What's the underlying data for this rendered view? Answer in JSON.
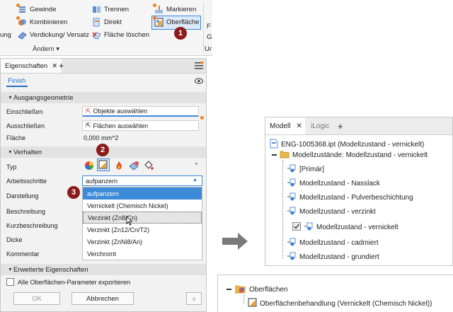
{
  "ribbon": {
    "col1": [
      "Gewinde",
      "Kombinieren",
      "Verdickung/ Versatz"
    ],
    "col1_partial": "ung",
    "col2": [
      "Trennen",
      "Direkt",
      "Fläche löschen"
    ],
    "col3": [
      "Markieren",
      "Oberfläche"
    ],
    "col4_partial": [
      "F",
      "G",
      "Ur"
    ],
    "group_label": "Ändern ▾"
  },
  "badges": {
    "one": "1",
    "two": "2",
    "three": "3"
  },
  "properties": {
    "tab_title": "Eigenschaften",
    "tab_close": "✕",
    "tab_add": "+",
    "finish": "Finish",
    "section_input": "Ausgangsgeometrie",
    "einschliessen_label": "Einschließen",
    "einschliessen_value": "Objekte auswählen",
    "ausschliessen_label": "Ausschließen",
    "ausschliessen_value": "Flächen auswählen",
    "flaeche_label": "Fläche",
    "flaeche_value": "0,000 mm^2",
    "section_behavior": "Verhalten",
    "typ_label": "Typ",
    "arbeitsschritte_label": "Arbeitsschritte",
    "arbeitsschritte_value": "aufpanzern",
    "darstellung_label": "Darstellung",
    "beschreibung_label": "Beschreibung",
    "kurzbeschreibung_label": "Kurzbeschreibung",
    "dicke_label": "Dicke",
    "kommentar_label": "Kommentar",
    "dropdown_options": [
      "aufpanzern",
      "Vernickelt (Chemisch Nickel)",
      "Verzinkt (Zn8/Cn)",
      "Verzinkt (Zn12/Cn/T2)",
      "Verzinkt (ZnNi8/An)",
      "Verchromt"
    ],
    "dropdown_selected_index": 0,
    "dropdown_hover_index": 2,
    "section_advanced": "Erweiterte Eigenschaften",
    "export_all_label": "Alle Oberflächen-Parameter exportieren",
    "ok_label": "OK",
    "cancel_label": "Abbrechen",
    "add_label": "+"
  },
  "model_browser": {
    "tab_model": "Modell",
    "tab_close": "✕",
    "tab_ilogic": "iLogic",
    "tab_add": "+",
    "file": "ENG-1005368.ipt (Modellzustand - vernickelt)",
    "states_folder": "Modellzustände: Modellzustand - vernickelt",
    "states": [
      "[Primär]",
      "Modellzustand - Nasslack",
      "Modellzustand - Pulverbeschichtung",
      "Modellzustand - verzinkt",
      "Modellzustand - vernickelt",
      "Modellzustand - cadmiert",
      "Modellzustand - grundiert"
    ],
    "active_state_index": 4
  },
  "surfaces_tree": {
    "folder": "Oberflächen",
    "item": "Oberflächenbehandlung (Vernickelt (Chemisch Nickel))"
  },
  "colors": {
    "accent": "#1f6fbf",
    "badge": "#8b1a1a",
    "orange_dot": "#f08020",
    "folder": "#e9b949"
  }
}
